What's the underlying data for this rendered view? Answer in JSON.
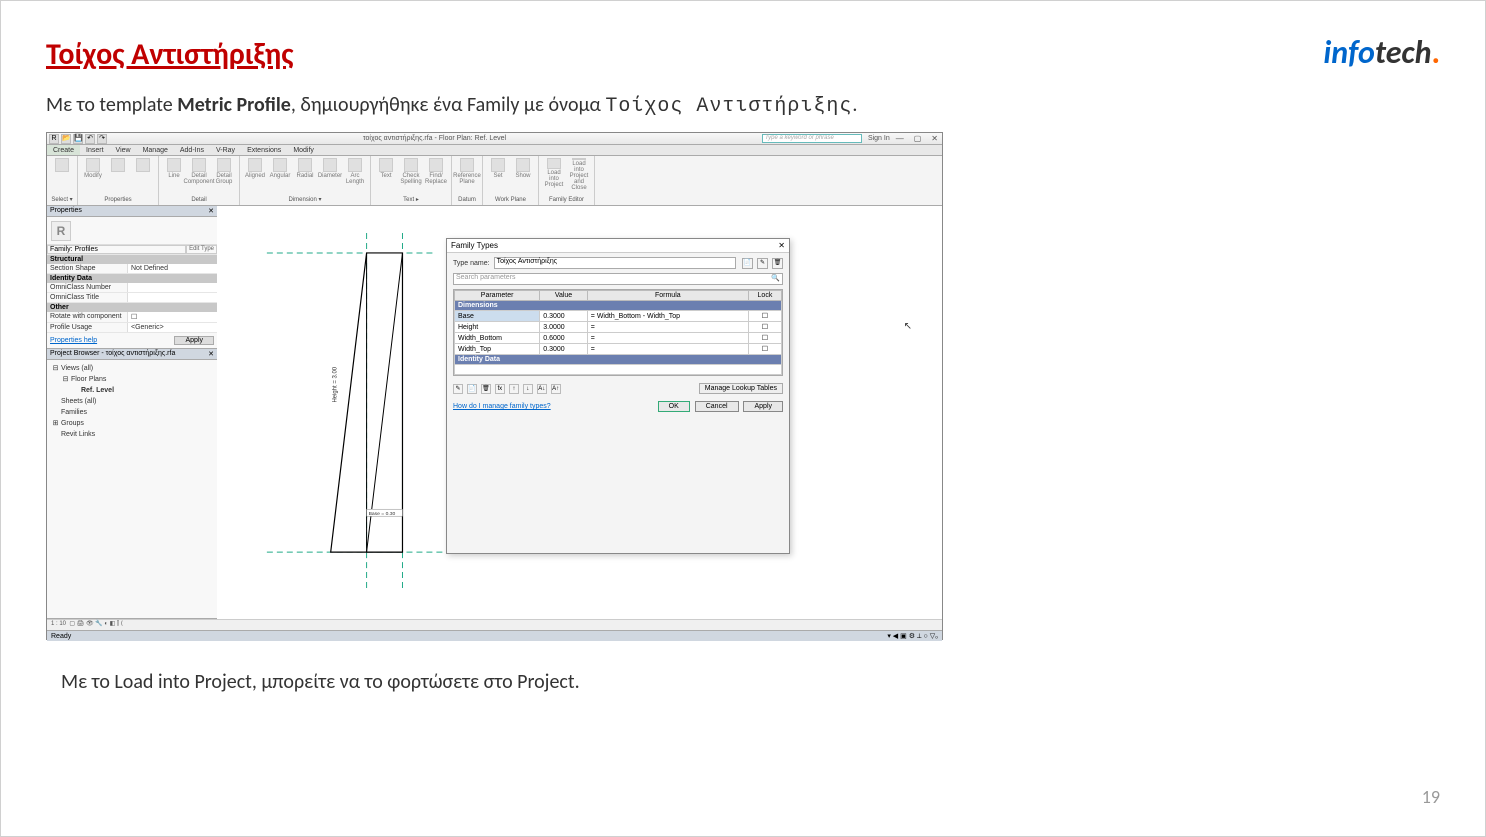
{
  "slide": {
    "title": "Τοίχος Αντιστήριξης",
    "desc_pre": "Με το template ",
    "desc_bold": "Metric Profile",
    "desc_mid": ", δημιουργήθηκε ένα Family με όνομα ",
    "desc_mono": "Τοίχος Αντιστήριξης",
    "desc_end": ".",
    "desc2": "Με το Load into Project, μπορείτε να το φορτώσετε στο Project.",
    "page_num": "19"
  },
  "logo": {
    "info": "info",
    "tech": "tech",
    "dot": "."
  },
  "revit": {
    "window_title": "τοίχος αντιστήριξης.rfa - Floor Plan: Ref. Level",
    "search_placeholder": "Type a keyword or phrase",
    "signin": "Sign In",
    "tabs": [
      "Create",
      "Insert",
      "View",
      "Manage",
      "Add-Ins",
      "V-Ray",
      "Extensions",
      "Modify"
    ],
    "ribbon": {
      "panels": [
        {
          "title": "Select ▾",
          "btns": [
            ""
          ]
        },
        {
          "title": "Properties",
          "btns": [
            "Modify",
            "",
            ""
          ]
        },
        {
          "title": "Detail",
          "btns": [
            "Line",
            "Detail Component",
            "Detail Group"
          ]
        },
        {
          "title": "Dimension ▾",
          "btns": [
            "Aligned",
            "Angular",
            "Radial",
            "Diameter",
            "Arc Length"
          ]
        },
        {
          "title": "Text       ▸",
          "btns": [
            "Text",
            "Check Spelling",
            "Find/ Replace"
          ]
        },
        {
          "title": "Datum",
          "btns": [
            "Reference Plane"
          ]
        },
        {
          "title": "Work Plane",
          "btns": [
            "Set",
            "Show"
          ]
        },
        {
          "title": "Family Editor",
          "btns": [
            "Load into Project",
            "Load into Project and Close"
          ]
        }
      ]
    },
    "properties": {
      "panel_title": "Properties",
      "family_selector": "Family: Profiles",
      "edit_type": "Edit Type",
      "groups": [
        {
          "cat": "Structural",
          "rows": [
            {
              "k": "Section Shape",
              "v": "Not Defined"
            }
          ]
        },
        {
          "cat": "Identity Data",
          "rows": [
            {
              "k": "OmniClass Number",
              "v": ""
            },
            {
              "k": "OmniClass Title",
              "v": ""
            }
          ]
        },
        {
          "cat": "Other",
          "rows": [
            {
              "k": "Rotate with component",
              "v": "☐"
            },
            {
              "k": "Profile Usage",
              "v": "<Generic>"
            }
          ]
        }
      ],
      "help": "Properties help",
      "apply": "Apply"
    },
    "browser": {
      "title": "Project Browser - τοίχος αντιστήριξης.rfa",
      "tree": [
        {
          "lvl": 0,
          "ico": "⊟",
          "txt": "Views (all)"
        },
        {
          "lvl": 1,
          "ico": "⊟",
          "txt": "Floor Plans"
        },
        {
          "lvl": 2,
          "ico": "",
          "txt": "Ref. Level",
          "bold": true
        },
        {
          "lvl": 0,
          "ico": "",
          "txt": "Sheets (all)"
        },
        {
          "lvl": 0,
          "ico": "",
          "txt": "Families"
        },
        {
          "lvl": 0,
          "ico": "⊞",
          "txt": "Groups"
        },
        {
          "lvl": 0,
          "ico": "",
          "txt": "Revit Links"
        }
      ]
    },
    "view_scale": "1 : 10",
    "status": "Ready",
    "dim_label": "Base = 0.30"
  },
  "dialog": {
    "title": "Family Types",
    "type_name_label": "Type name:",
    "type_name_value": "Τοίχος Αντιστήριξης",
    "search_placeholder": "Search parameters",
    "headers": [
      "Parameter",
      "Value",
      "Formula",
      "Lock"
    ],
    "sections": [
      {
        "name": "Dimensions",
        "rows": [
          {
            "p": "Base",
            "v": "0.3000",
            "f": "= Width_Bottom - Width_Top",
            "l": "☐"
          },
          {
            "p": "Height",
            "v": "3.0000",
            "f": "=",
            "l": "☐"
          },
          {
            "p": "Width_Bottom",
            "v": "0.6000",
            "f": "=",
            "l": "☐"
          },
          {
            "p": "Width_Top",
            "v": "0.3000",
            "f": "=",
            "l": "☐"
          }
        ]
      },
      {
        "name": "Identity Data",
        "rows": []
      }
    ],
    "manage_lookup": "Manage Lookup Tables",
    "help": "How do I manage family types?",
    "ok": "OK",
    "cancel": "Cancel",
    "apply": "Apply"
  }
}
